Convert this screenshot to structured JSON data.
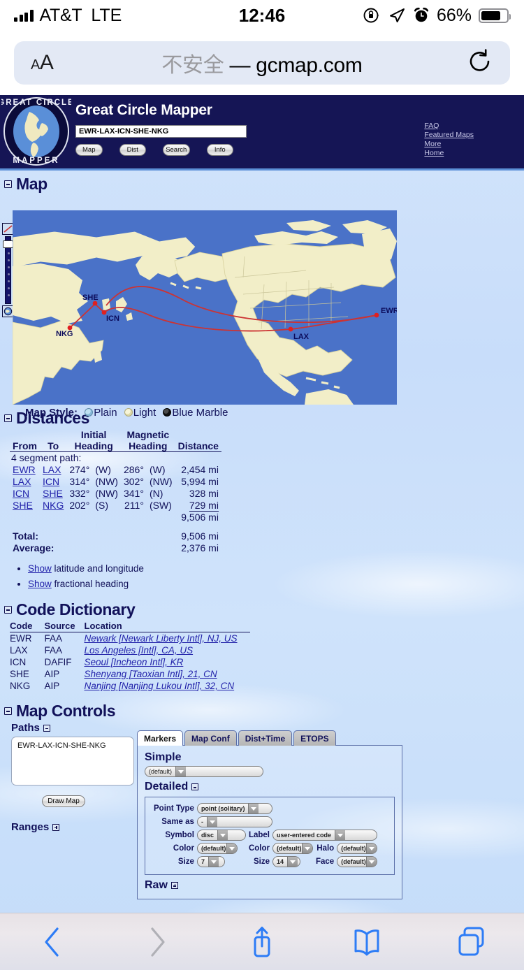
{
  "status_bar": {
    "carrier": "AT&T",
    "network": "LTE",
    "time": "12:46",
    "battery_percent": "66%",
    "icons": [
      "signal-bars-icon",
      "rotation-lock-icon",
      "location-arrow-icon",
      "alarm-clock-icon",
      "battery-icon"
    ]
  },
  "browser": {
    "text_size_small": "A",
    "text_size_large": "A",
    "url_insecure_label": "不安全",
    "url_separator": "—",
    "url_domain": "gcmap.com",
    "reload_icon": "reload-icon",
    "toolbar": {
      "back": "back-icon",
      "forward": "forward-icon",
      "share": "share-icon",
      "bookmarks": "bookmarks-icon",
      "tabs": "tabs-icon"
    }
  },
  "site_header": {
    "title": "Great Circle Mapper",
    "logo_top_text": "GREAT CIRCLE",
    "logo_bottom_text": "MAPPER",
    "search_value": "EWR-LAX-ICN-SHE-NKG",
    "buttons": [
      "Map",
      "Dist",
      "Search",
      "Info"
    ],
    "corner_links": [
      "FAQ",
      "Featured Maps",
      "More",
      "Home"
    ],
    "bg_color": "#151555"
  },
  "sections": {
    "map": {
      "title": "Map",
      "collapsed": false
    },
    "distances": {
      "title": "Distances"
    },
    "code_dictionary": {
      "title": "Code Dictionary"
    },
    "map_controls": {
      "title": "Map Controls"
    }
  },
  "map": {
    "style_label": "Map Style:",
    "styles": [
      {
        "label": "Plain",
        "selected": false
      },
      {
        "label": "Light",
        "selected": false
      },
      {
        "label": "Blue Marble",
        "selected": true
      }
    ],
    "markers": [
      "SHE",
      "ICN",
      "NKG",
      "LAX",
      "EWR"
    ],
    "route_color": "#cc3333",
    "ocean_color": "#4a72c8",
    "land_color": "#f2eec8",
    "zoom_slider": {
      "min_icon": "line-icon",
      "max_icon": "globe-icon"
    }
  },
  "distances": {
    "headers": {
      "from": "From",
      "to": "To",
      "initial": "Initial",
      "magnetic": "Magnetic",
      "heading": "Heading",
      "distance": "Distance"
    },
    "segment_label": "4 segment path:",
    "rows": [
      {
        "from": "EWR",
        "to": "LAX",
        "initial": "274°",
        "initial_dir": "(W)",
        "magnetic": "286°",
        "magnetic_dir": "(W)",
        "distance": "2,454 mi"
      },
      {
        "from": "LAX",
        "to": "ICN",
        "initial": "314°",
        "initial_dir": "(NW)",
        "magnetic": "302°",
        "magnetic_dir": "(NW)",
        "distance": "5,994 mi"
      },
      {
        "from": "ICN",
        "to": "SHE",
        "initial": "332°",
        "initial_dir": "(NW)",
        "magnetic": "341°",
        "magnetic_dir": "(N)",
        "distance": "328 mi"
      },
      {
        "from": "SHE",
        "to": "NKG",
        "initial": "202°",
        "initial_dir": "(S)",
        "magnetic": "211°",
        "magnetic_dir": "(SW)",
        "distance": "729 mi"
      }
    ],
    "subtotal": "9,506 mi",
    "total_label": "Total:",
    "total_value": "9,506 mi",
    "average_label": "Average:",
    "average_value": "2,376 mi",
    "show_links": [
      {
        "link": "Show",
        "text": " latitude and longitude"
      },
      {
        "link": "Show",
        "text": " fractional heading"
      }
    ]
  },
  "code_dictionary": {
    "headers": {
      "code": "Code",
      "source": "Source",
      "location": "Location"
    },
    "rows": [
      {
        "code": "EWR",
        "source": "FAA",
        "location": "Newark [Newark Liberty Intl], NJ, US"
      },
      {
        "code": "LAX",
        "source": "FAA",
        "location": "Los Angeles [Intl], CA, US"
      },
      {
        "code": "ICN",
        "source": "DAFIF",
        "location": "Seoul [Incheon Intl], KR"
      },
      {
        "code": "SHE",
        "source": "AIP",
        "location": "Shenyang [Taoxian Intl], 21, CN"
      },
      {
        "code": "NKG",
        "source": "AIP",
        "location": "Nanjing [Nanjing Lukou Intl], 32, CN"
      }
    ]
  },
  "map_controls": {
    "paths_label": "Paths",
    "paths_value": "EWR-LAX-ICN-SHE-NKG",
    "draw_map_label": "Draw Map",
    "ranges_label": "Ranges",
    "tabs": [
      {
        "label": "Markers",
        "active": true
      },
      {
        "label": "Map Conf",
        "active": false
      },
      {
        "label": "Dist+Time",
        "active": false
      },
      {
        "label": "ETOPS",
        "active": false
      }
    ],
    "simple_label": "Simple",
    "simple_value": "(default)",
    "detailed_label": "Detailed",
    "raw_label": "Raw",
    "detailed": {
      "point_type_label": "Point Type",
      "point_type_value": "point (solitary)",
      "same_as_label": "Same as",
      "same_as_value": "-",
      "symbol_label": "Symbol",
      "symbol_value": "disc",
      "label_label": "Label",
      "label_value": "user-entered code",
      "color1_label": "Color",
      "color1_value": "(default)",
      "color2_label": "Color",
      "color2_value": "(default)",
      "halo_label": "Halo",
      "halo_value": "(default)",
      "size1_label": "Size",
      "size1_value": "7",
      "size2_label": "Size",
      "size2_value": "14",
      "face_label": "Face",
      "face_value": "(default)"
    }
  }
}
